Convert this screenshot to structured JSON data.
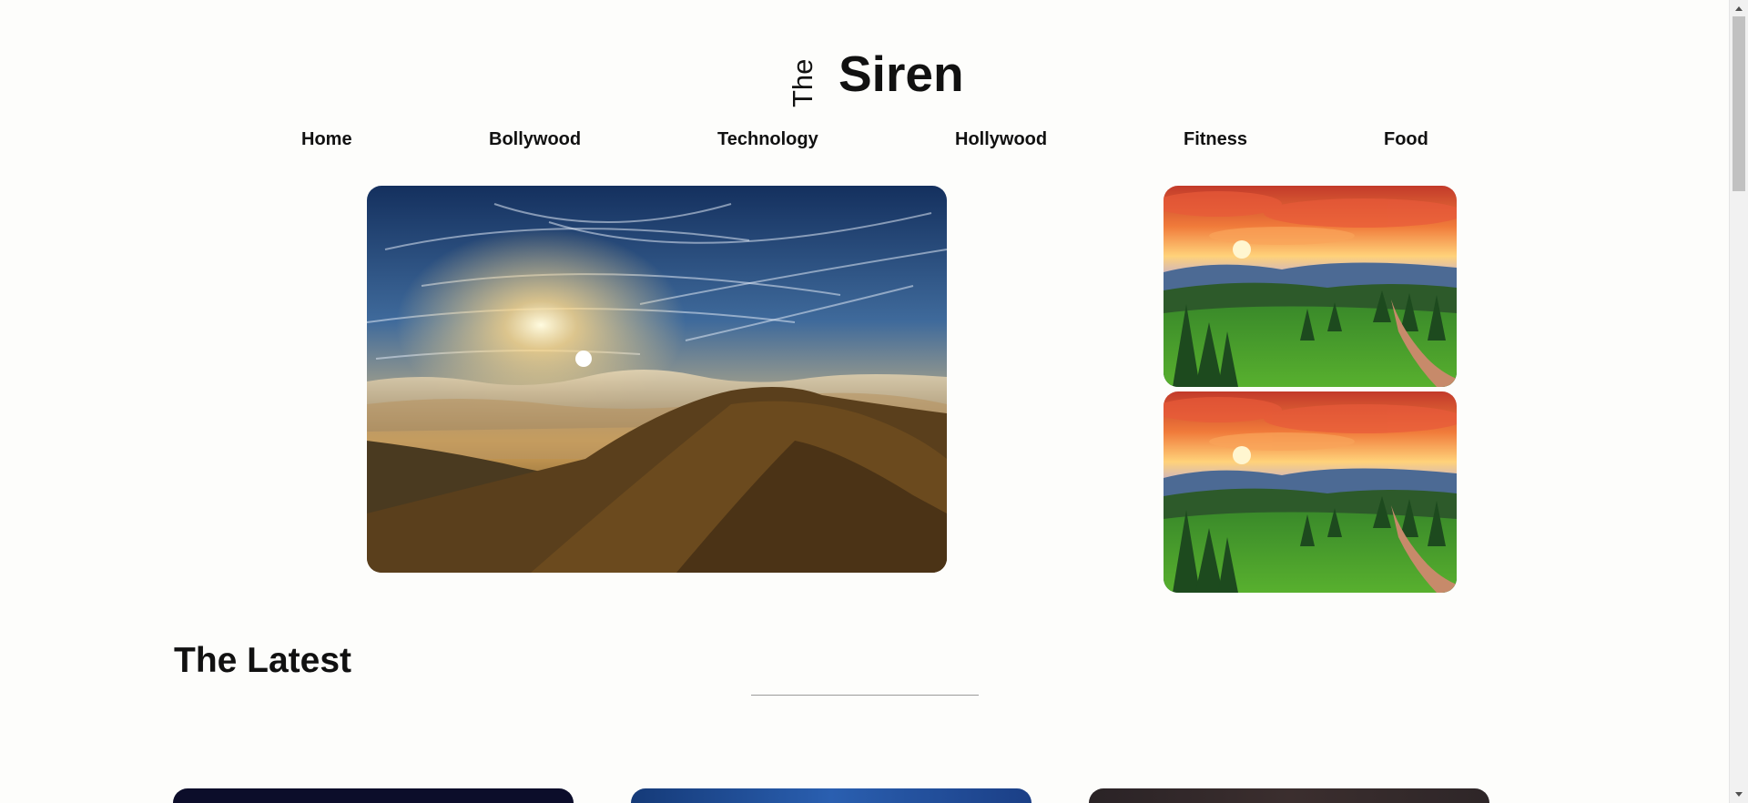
{
  "logo": {
    "small": "The",
    "large": "Siren"
  },
  "nav": {
    "items": [
      {
        "label": "Home"
      },
      {
        "label": "Bollywood"
      },
      {
        "label": "Technology"
      },
      {
        "label": "Hollywood"
      },
      {
        "label": "Fitness"
      },
      {
        "label": "Food"
      }
    ]
  },
  "hero": {
    "main_image": "mountain-sunrise-above-clouds",
    "side_images": [
      "sunset-forest-path",
      "sunset-forest-path"
    ]
  },
  "latest": {
    "title": "The Latest"
  },
  "colors": {
    "background": "#fdfdfb",
    "text": "#111111",
    "divider": "#9a9a9a"
  }
}
